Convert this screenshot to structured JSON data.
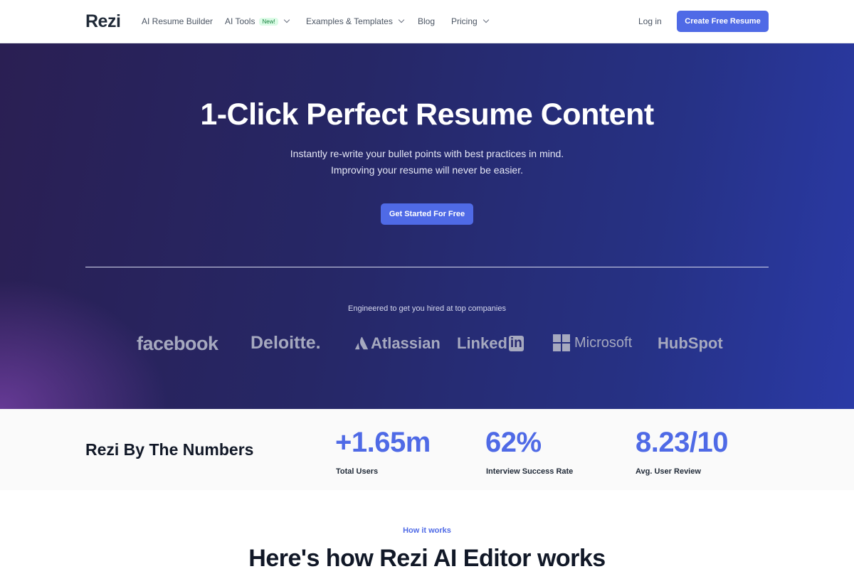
{
  "nav": {
    "logo": "Rezi",
    "links": [
      {
        "label": "AI Resume Builder"
      },
      {
        "label": "AI Tools",
        "badge": "New!"
      },
      {
        "label": "Examples & Templates"
      },
      {
        "label": "Blog"
      },
      {
        "label": "Pricing"
      }
    ],
    "login": "Log in",
    "cta": "Create Free Resume"
  },
  "hero": {
    "title": "1-Click Perfect Resume Content",
    "subtitle_line1": "Instantly re-write your bullet points with best practices in mind.",
    "subtitle_line2": "Improving your resume will never be easier.",
    "cta": "Get Started For Free",
    "engineered": "Engineered to get you hired at top companies",
    "companies": {
      "facebook": "facebook",
      "deloitte": "Deloitte.",
      "atlassian": "Atlassian",
      "linkedin": "Linked",
      "linkedin_in": "in",
      "microsoft": "Microsoft",
      "hubspot": "HubSpot"
    }
  },
  "numbers": {
    "title": "Rezi By The Numbers",
    "stats": [
      {
        "value": "+1.65m",
        "label": "Total Users"
      },
      {
        "value": "62%",
        "label": "Interview Success Rate"
      },
      {
        "value": "8.23/10",
        "label": "Avg. User Review"
      }
    ]
  },
  "how_it_works": {
    "eyebrow": "How it works",
    "title": "Here's how Rezi AI Editor works"
  },
  "colors": {
    "accent": "#4f6ae6",
    "hero_bg": "#262766",
    "badge_text": "#15803d"
  }
}
